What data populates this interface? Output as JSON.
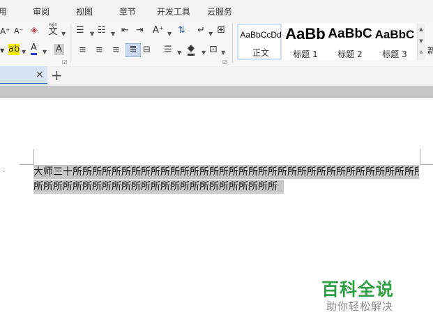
{
  "menu": {
    "items": [
      {
        "label": "用"
      },
      {
        "label": "审阅"
      },
      {
        "label": "视图"
      },
      {
        "label": "章节"
      },
      {
        "label": "开发工具"
      },
      {
        "label": "云服务"
      }
    ]
  },
  "ribbon": {
    "font_group_icons": [
      "grow-font-icon",
      "shrink-font-icon",
      "clear-format-icon",
      "phonetic-guide-icon",
      "highlight-icon",
      "font-color-icon",
      "char-shading-icon"
    ],
    "phonetic_label": "wén",
    "phonetic_char": "文",
    "styles": [
      {
        "sample": "AaBbCcDd",
        "name": "正文"
      },
      {
        "sample": "AaBb",
        "name": "标题 1"
      },
      {
        "sample": "AaBbC",
        "name": "标题 2"
      },
      {
        "sample": "AaBbC",
        "name": "标题 3"
      }
    ],
    "overflow_label": "新"
  },
  "tabs": {
    "close_glyph": "×",
    "add_glyph": "+"
  },
  "document": {
    "lines": [
      "大师三十所所所所所所所所所所所所所所所所所所所所所所所所所所所所所所所所所所所所所所",
      "所所所所所所所所所所所所所所所所所所所所所所所所所"
    ]
  },
  "watermark": {
    "title": "百科全说",
    "subtitle": "助你轻松解决"
  },
  "colors": {
    "selection": "#c8c8c8",
    "watermark_green": "#2ea043",
    "tab_accent": "#4a78c2"
  }
}
